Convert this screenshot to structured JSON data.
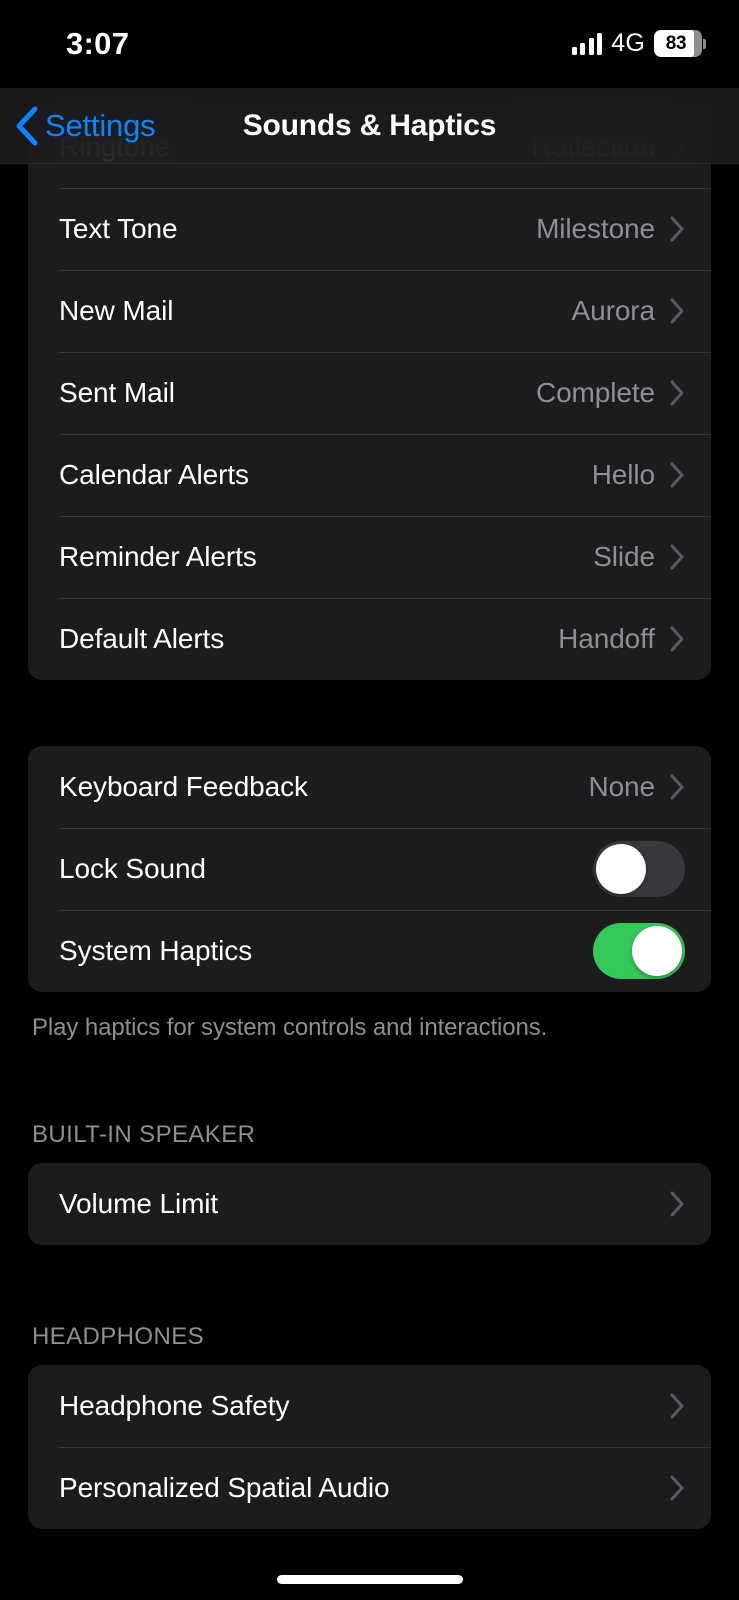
{
  "status_bar": {
    "time": "3:07",
    "network": "4G",
    "battery_percent": "83",
    "signal_icon": "signal-bars-icon",
    "battery_icon": "battery-icon"
  },
  "nav": {
    "back_label": "Settings",
    "back_icon": "chevron-left-icon",
    "title": "Sounds & Haptics"
  },
  "colors": {
    "accent_blue": "#0a84ff",
    "toggle_on_green": "#34c759",
    "toggle_off_gray": "#39393d",
    "card_bg": "#1c1c1e",
    "page_bg": "#000000",
    "secondary_text": "#8e8e93",
    "separator": "#38383a"
  },
  "sections": [
    {
      "name": "sounds-and-vibration-patterns",
      "header": "",
      "footer": "",
      "rows": [
        {
          "label": "Ringtone",
          "value": "Reflection",
          "type": "disclosure",
          "clipped": true
        },
        {
          "label": "Text Tone",
          "value": "Milestone",
          "type": "disclosure"
        },
        {
          "label": "New Mail",
          "value": "Aurora",
          "type": "disclosure"
        },
        {
          "label": "Sent Mail",
          "value": "Complete",
          "type": "disclosure"
        },
        {
          "label": "Calendar Alerts",
          "value": "Hello",
          "type": "disclosure"
        },
        {
          "label": "Reminder Alerts",
          "value": "Slide",
          "type": "disclosure"
        },
        {
          "label": "Default Alerts",
          "value": "Handoff",
          "type": "disclosure"
        }
      ]
    },
    {
      "name": "keyboard-and-system",
      "header": "",
      "footer": "Play haptics for system controls and interactions.",
      "rows": [
        {
          "label": "Keyboard Feedback",
          "value": "None",
          "type": "disclosure"
        },
        {
          "label": "Lock Sound",
          "value": "",
          "type": "toggle",
          "toggle_state": "off"
        },
        {
          "label": "System Haptics",
          "value": "",
          "type": "toggle",
          "toggle_state": "on"
        }
      ]
    },
    {
      "name": "built-in-speaker",
      "header": "BUILT-IN SPEAKER",
      "footer": "",
      "rows": [
        {
          "label": "Volume Limit",
          "value": "",
          "type": "disclosure"
        }
      ]
    },
    {
      "name": "headphones",
      "header": "HEADPHONES",
      "footer": "",
      "rows": [
        {
          "label": "Headphone Safety",
          "value": "",
          "type": "disclosure"
        },
        {
          "label": "Personalized Spatial Audio",
          "value": "",
          "type": "disclosure"
        }
      ]
    }
  ],
  "home_indicator": "home-indicator"
}
